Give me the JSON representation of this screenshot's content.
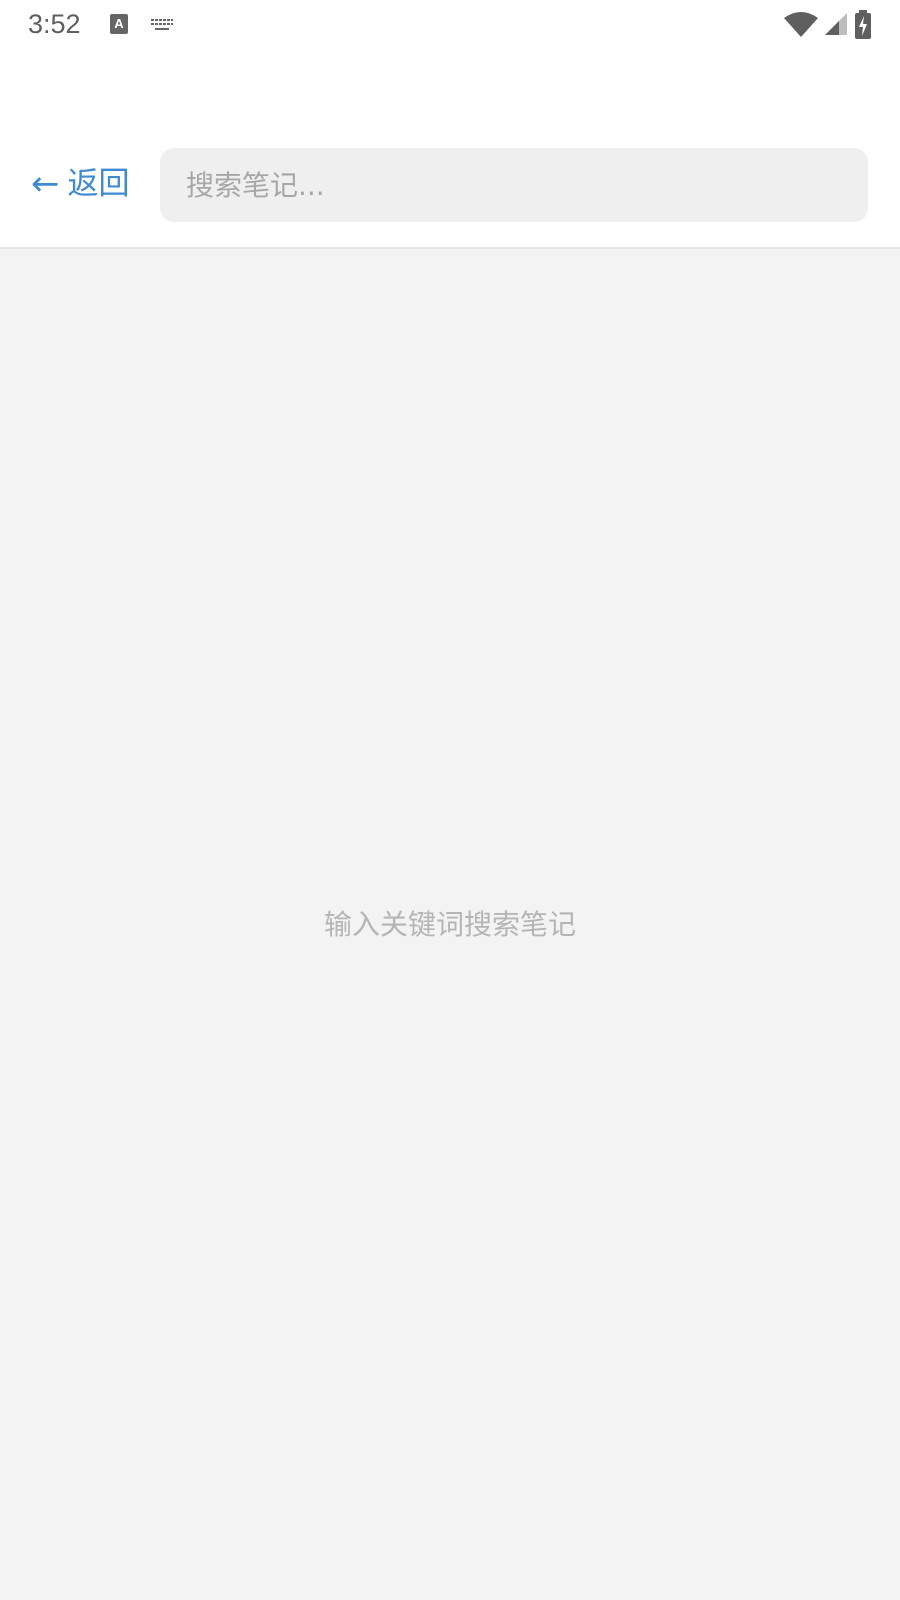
{
  "status_bar": {
    "time": "3:52",
    "icons": [
      "a-notification-icon",
      "keyboard-icon",
      "wifi-icon",
      "signal-icon",
      "battery-charging-icon"
    ]
  },
  "header": {
    "back_arrow": "←",
    "back_label": "返回",
    "search": {
      "placeholder": "搜索笔记...",
      "value": ""
    }
  },
  "main": {
    "empty_hint": "输入关键词搜索笔记"
  },
  "colors": {
    "accent": "#3f8bd3",
    "background": "#f3f3f3",
    "header_bg": "#ffffff",
    "search_bg": "#efefef",
    "hint_text": "#b5b5b5"
  }
}
